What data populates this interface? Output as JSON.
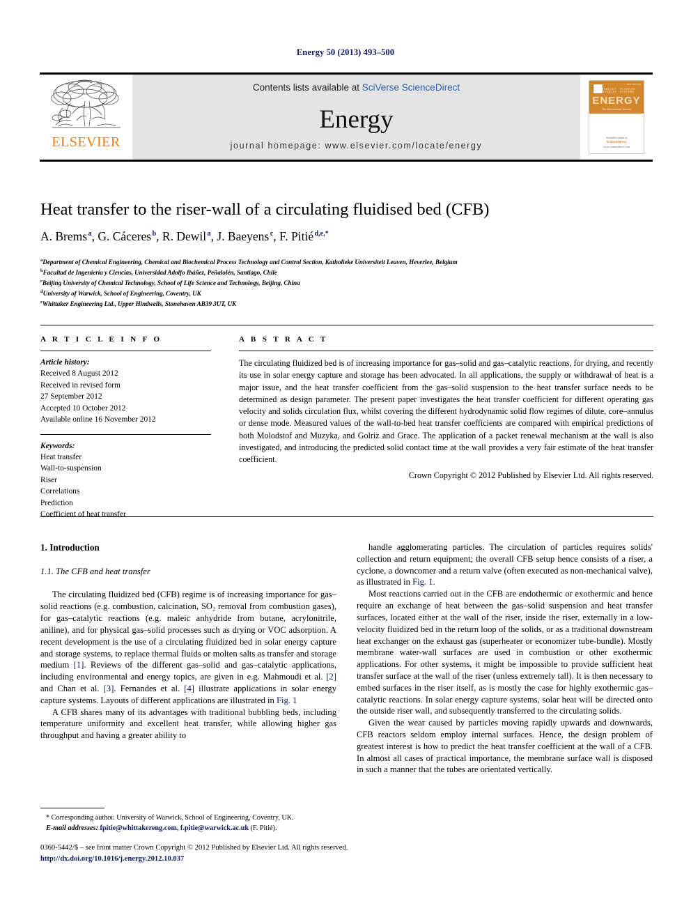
{
  "running_head": "Energy 50 (2013) 493–500",
  "masthead": {
    "publisher_name": "ELSEVIER",
    "contents_prefix": "Contents lists available at ",
    "contents_link": "SciVerse ScienceDirect",
    "journal_title": "Energy",
    "homepage": "journal homepage: www.elsevier.com/locate/energy",
    "cover": {
      "title": "ENERGY",
      "kicker": "TECHNOLOGY · SCIENCES · RESOURCES · SYSTEMS",
      "sub": "The International Journal",
      "topright": "ISSN 0360-5442",
      "available_at": "Available online at",
      "sd_label": "ScienceDirect",
      "sd_url": "www.sciencedirect.com"
    }
  },
  "article": {
    "title": "Heat transfer to the riser-wall of a circulating fluidised bed (CFB)",
    "authors": [
      {
        "name": "A. Brems",
        "marks": "a"
      },
      {
        "name": "G. Cáceres",
        "marks": "b"
      },
      {
        "name": "R. Dewil",
        "marks": "a"
      },
      {
        "name": "J. Baeyens",
        "marks": "c"
      },
      {
        "name": "F. Pitié",
        "marks": "d,e,*"
      }
    ],
    "affiliations": [
      {
        "mark": "a",
        "text": "Department of Chemical Engineering, Chemical and Biochemical Process Technology and Control Section, Katholieke Universiteit Leuven, Heverlee, Belgium"
      },
      {
        "mark": "b",
        "text": "Facultad de Ingeniería y Ciencias, Universidad Adolfo Ibáñez, Peñalolén, Santiago, Chile"
      },
      {
        "mark": "c",
        "text": "Beijing University of Chemical Technology, School of Life Science and Technology, Beijing, China"
      },
      {
        "mark": "d",
        "text": "University of Warwick, School of Engineering, Coventry, UK"
      },
      {
        "mark": "e",
        "text": "Whittaker Engineering Ltd., Upper Hindwells, Stonehaven AB39 3UT, UK"
      }
    ]
  },
  "article_info": {
    "heading": "A R T I C L E   I N F O",
    "history_label": "Article history:",
    "history": [
      "Received 8 August 2012",
      "Received in revised form",
      "27 September 2012",
      "Accepted 10 October 2012",
      "Available online 16 November 2012"
    ],
    "keywords_label": "Keywords:",
    "keywords": [
      "Heat transfer",
      "Wall-to-suspension",
      "Riser",
      "Correlations",
      "Prediction",
      "Coefficient of heat transfer"
    ]
  },
  "abstract": {
    "heading": "A B S T R A C T",
    "text": "The circulating fluidized bed is of increasing importance for gas–solid and gas–catalytic reactions, for drying, and recently its use in solar energy capture and storage has been advocated. In all applications, the supply or withdrawal of heat is a major issue, and the heat transfer coefficient from the gas–solid suspension to the heat transfer surface needs to be determined as design parameter. The present paper investigates the heat transfer coefficient for different operating gas velocity and solids circulation flux, whilst covering the different hydrodynamic solid flow regimes of dilute, core–annulus or dense mode. Measured values of the wall-to-bed heat transfer coefficients are compared with empirical predictions of both Molodstof and Muzyka, and Golriz and Grace. The application of a packet renewal mechanism at the wall is also investigated, and introducing the predicted solid contact time at the wall provides a very fair estimate of the heat transfer coefficient.",
    "copyright": "Crown Copyright © 2012 Published by Elsevier Ltd. All rights reserved."
  },
  "body": {
    "section_number_title": "1.  Introduction",
    "subsection_number_title": "1.1.  The CFB and heat transfer",
    "left_paragraphs": [
      "The circulating fluidized bed (CFB) regime is of increasing importance for gas–solid reactions (e.g. combustion, calcination, SO₂ removal from combustion gases), for gas–catalytic reactions (e.g. maleic anhydride from butane, acrylonitrile, aniline), and for physical gas–solid processes such as drying or VOC adsorption. A recent development is the use of a circulating fluidized bed in solar energy capture and storage systems, to replace thermal fluids or molten salts as transfer and storage medium [1]. Reviews of the different gas–solid and gas–catalytic applications, including environmental and energy topics, are given in e.g. Mahmoudi et al. [2] and Chan et al. [3]. Fernandes et al. [4] illustrate applications in solar energy capture systems. Layouts of different applications are illustrated in Fig. 1",
      "A CFB shares many of its advantages with traditional bubbling beds, including temperature uniformity and excellent heat transfer, while allowing higher gas throughput and having a greater ability to"
    ],
    "right_paragraphs": [
      "handle agglomerating particles. The circulation of particles requires solids' collection and return equipment; the overall CFB setup hence consists of a riser, a cyclone, a downcomer and a return valve (often executed as non-mechanical valve), as illustrated in Fig. 1.",
      "Most reactions carried out in the CFB are endothermic or exothermic and hence require an exchange of heat between the gas–solid suspension and heat transfer surfaces, located either at the wall of the riser, inside the riser, externally in a low-velocity fluidized bed in the return loop of the solids, or as a traditional downstream heat exchanger on the exhaust gas (superheater or economizer tube-bundle). Mostly membrane water-wall surfaces are used in combustion or other exothermic applications. For other systems, it might be impossible to provide sufficient heat transfer surface at the wall of the riser (unless extremely tall). It is then necessary to embed surfaces in the riser itself, as is mostly the case for highly exothermic gas–catalytic reactions. In solar energy capture systems, solar heat will be directed onto the outside riser wall, and subsequently transferred to the circulating solids.",
      "Given the wear caused by particles moving rapidly upwards and downwards, CFB reactors seldom employ internal surfaces. Hence, the design problem of greatest interest is how to predict the heat transfer coefficient at the wall of a CFB. In almost all cases of practical importance, the membrane surface wall is disposed in such a manner that the tubes are orientated vertically."
    ]
  },
  "footnotes": {
    "corresponding": "* Corresponding author. University of Warwick, School of Engineering, Coventry, UK.",
    "email_label": "E-mail addresses:",
    "emails": "fpitie@whittakereng.com, f.pitie@warwick.ac.uk",
    "email_attrib": "(F. Pitié)."
  },
  "colophon": {
    "line1": "0360-5442/$ – see front matter Crown Copyright © 2012 Published by Elsevier Ltd. All rights reserved.",
    "doi": "http://dx.doi.org/10.1016/j.energy.2012.10.037"
  }
}
